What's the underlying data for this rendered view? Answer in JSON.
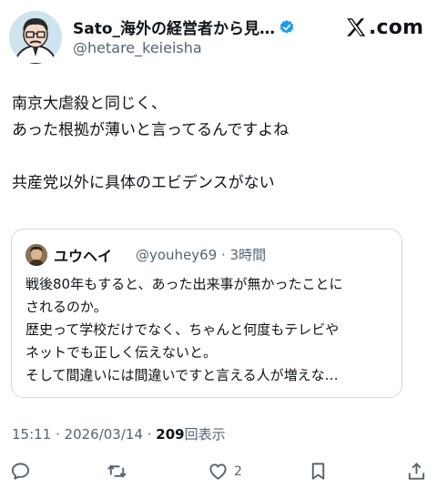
{
  "header": {
    "display_name": "Sato_海外の経営者から見…",
    "handle": "@hetare_keieisha",
    "brand": ".com",
    "icons": [
      "avatar",
      "verified-badge-icon",
      "x-logo-icon"
    ]
  },
  "tweet": {
    "lines": [
      "南京大虐殺と同じく、",
      "あった根拠が薄いと言ってるんですよね",
      "",
      "共産党以外に具体のエビデンスがない"
    ]
  },
  "quote": {
    "name": "ユウヘイ",
    "meta": "@youhey69 · 3時間",
    "lines": [
      "戦後80年もすると、あった出来事が無かったことに",
      "されるのか。",
      "歴史って学校だけでなく、ちゃんと何度もテレビや",
      "ネットでも正しく伝えないと。",
      "そして間違いには間違いですと言える人が増えな…"
    ]
  },
  "meta": {
    "timestamp": "15:11 · 2026/03/14 · ",
    "views": "209",
    "views_label": "回表示"
  },
  "actions": {
    "reply_icon": "reply-icon",
    "repost_icon": "repost-icon",
    "like_icon": "heart-icon",
    "like_count": "2",
    "bookmark_icon": "bookmark-icon",
    "share_icon": "share-icon"
  },
  "colors": {
    "text": "#0f1419",
    "secondary": "#536471",
    "verified": "#1d9bf0",
    "border": "#cfd9de"
  }
}
